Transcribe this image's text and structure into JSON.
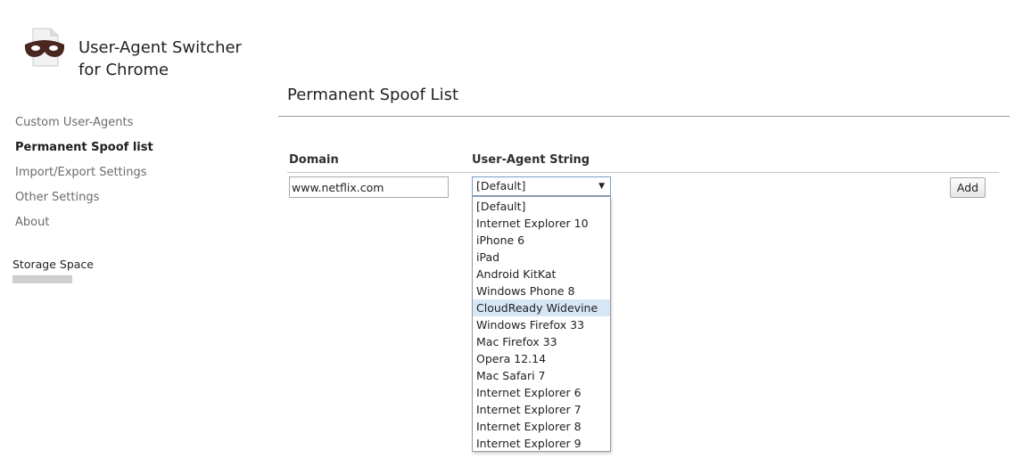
{
  "app": {
    "title": "User-Agent Switcher for Chrome",
    "logo_icon": "spy-mask-icon"
  },
  "sidebar": {
    "items": [
      {
        "label": "Custom User-Agents",
        "active": false
      },
      {
        "label": "Permanent Spoof list",
        "active": true
      },
      {
        "label": "Import/Export Settings",
        "active": false
      },
      {
        "label": "Other Settings",
        "active": false
      },
      {
        "label": "About",
        "active": false
      }
    ],
    "storage_label": "Storage Space",
    "storage_used_fraction": 1.0
  },
  "main": {
    "title": "Permanent Spoof List",
    "columns": {
      "domain": "Domain",
      "ua_string": "User-Agent String"
    },
    "domain_value": "www.netflix.com",
    "ua_selected": "[Default]",
    "ua_options": [
      "[Default]",
      "Internet Explorer 10",
      "iPhone 6",
      "iPad",
      "Android KitKat",
      "Windows Phone 8",
      "CloudReady Widevine",
      "Windows Firefox 33",
      "Mac Firefox 33",
      "Opera 12.14",
      "Mac Safari 7",
      "Internet Explorer 6",
      "Internet Explorer 7",
      "Internet Explorer 8",
      "Internet Explorer 9"
    ],
    "ua_highlighted_index": 6,
    "add_label": "Add"
  },
  "colors": {
    "highlight": "#d6e6f6",
    "select_border": "#7a9cc8"
  }
}
